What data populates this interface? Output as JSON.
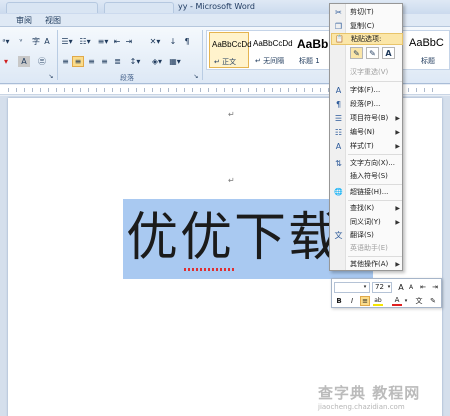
{
  "window": {
    "title": "yy - Microsoft Word"
  },
  "ribbon_tabs": [
    "审阅",
    "视图"
  ],
  "ribbon": {
    "paragraph_group_label": "段落",
    "styles": [
      {
        "sample": "AaBbCcDd",
        "name": "↵ 正文",
        "selected": true
      },
      {
        "sample": "AaBbCcDd",
        "name": "↵ 无间隔",
        "selected": false
      },
      {
        "sample": "AaBb",
        "name": "标题 1",
        "selected": false
      },
      {
        "sample": "AaBbC",
        "name": "标题",
        "selected": false
      }
    ]
  },
  "document": {
    "paragraph_marks": [
      "↵",
      "↵",
      "↵"
    ],
    "selected_text": "优优下载"
  },
  "context_menu": {
    "items": [
      {
        "icon": "scissors-icon",
        "glyph": "✂",
        "label": "剪切(T)"
      },
      {
        "icon": "copy-icon",
        "glyph": "❐",
        "label": "复制(C)"
      },
      {
        "icon": "paste-icon",
        "glyph": "📋",
        "label": "粘贴选项:",
        "hover": true
      },
      {
        "icon": "",
        "glyph": "",
        "label": "汉字重选(V)",
        "disabled": true
      },
      {
        "icon": "font-icon",
        "glyph": "A",
        "label": "字体(F)..."
      },
      {
        "icon": "paragraph-icon",
        "glyph": "¶",
        "label": "段落(P)..."
      },
      {
        "icon": "bullets-icon",
        "glyph": "☰",
        "label": "项目符号(B)",
        "submenu": true
      },
      {
        "icon": "numbering-icon",
        "glyph": "☷",
        "label": "编号(N)",
        "submenu": true
      },
      {
        "icon": "styles-icon",
        "glyph": "A",
        "label": "样式(T)",
        "submenu": true
      },
      {
        "icon": "text-direction-icon",
        "glyph": "⇅",
        "label": "文字方向(X)..."
      },
      {
        "icon": "",
        "glyph": "",
        "label": "插入符号(S)"
      },
      {
        "icon": "hyperlink-icon",
        "glyph": "🌐",
        "label": "超链接(H)..."
      },
      {
        "icon": "",
        "glyph": "",
        "label": "查找(K)",
        "submenu": true
      },
      {
        "icon": "",
        "glyph": "",
        "label": "同义词(Y)",
        "submenu": true
      },
      {
        "icon": "translate-icon",
        "glyph": "文",
        "label": "翻译(S)"
      },
      {
        "icon": "",
        "glyph": "",
        "label": "英语助手(E)",
        "disabled": true
      },
      {
        "icon": "",
        "glyph": "",
        "label": "其他操作(A)",
        "submenu": true
      }
    ],
    "paste_options": [
      "✎",
      "✎",
      "A"
    ]
  },
  "mini_toolbar": {
    "font_name": "",
    "font_size": "72",
    "buttons_row1": [
      "A",
      "A",
      "⇤",
      "⇥"
    ],
    "buttons_row2": [
      "B",
      "I",
      "U",
      "ab",
      "A",
      "A",
      "文",
      "✎"
    ]
  },
  "watermark": {
    "main": "查字典  教程网",
    "sub": "jiaocheng.chazidian.com"
  },
  "colors": {
    "selection": "#a9c9f1",
    "ribbon_highlight": "#fbdc8a"
  }
}
